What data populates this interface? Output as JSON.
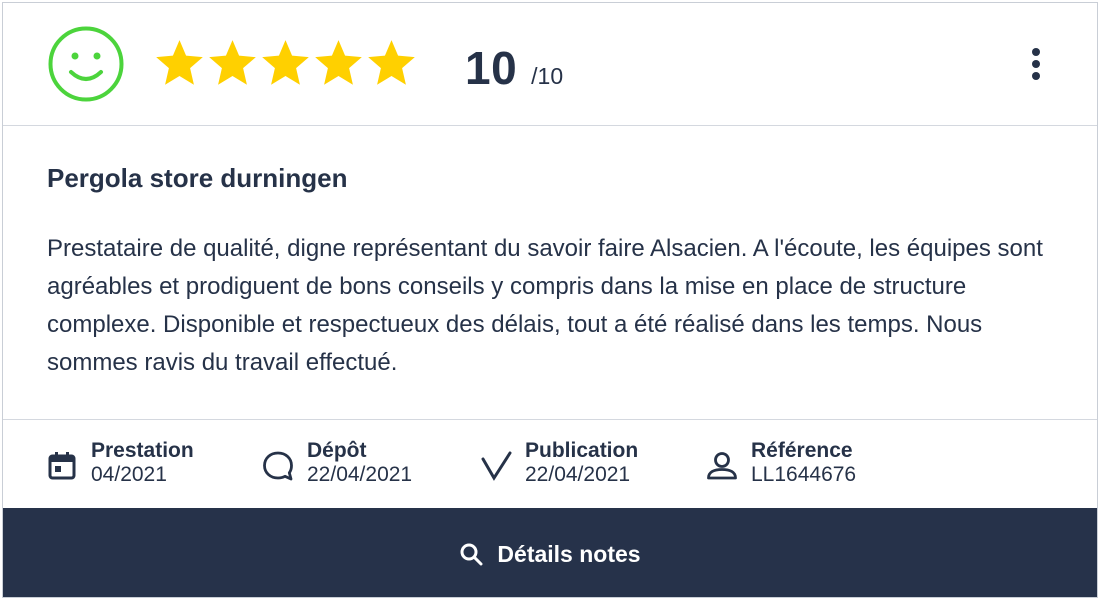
{
  "header": {
    "sentiment_icon": "smiley-face-icon",
    "sentiment_color": "#4cd43c",
    "rating_stars": 5,
    "rating_stars_max": 5,
    "star_color": "#ffd000",
    "score_value": "10",
    "score_max": "/10",
    "more_icon": "vertical-ellipsis-icon"
  },
  "review": {
    "title": "Pergola store durningen",
    "text": "Prestataire de qualité, digne représentant du savoir faire Alsacien. A l'écoute, les équipes sont agréables et prodiguent de bons conseils y compris dans la mise en place de structure complexe. Disponible et respectueux des délais, tout a été réalisé dans les temps. Nous sommes ravis du travail effectué."
  },
  "meta": {
    "prestation": {
      "icon": "calendar-icon",
      "label": "Prestation",
      "value": "04/2021"
    },
    "depot": {
      "icon": "speech-bubble-icon",
      "label": "Dépôt",
      "value": "22/04/2021"
    },
    "publication": {
      "icon": "checkmark-icon",
      "label": "Publication",
      "value": "22/04/2021"
    },
    "reference": {
      "icon": "user-icon",
      "label": "Référence",
      "value": "LL1644676"
    }
  },
  "footer": {
    "details_icon": "search-icon",
    "details_label": "Détails notes",
    "background": "#26324a"
  }
}
